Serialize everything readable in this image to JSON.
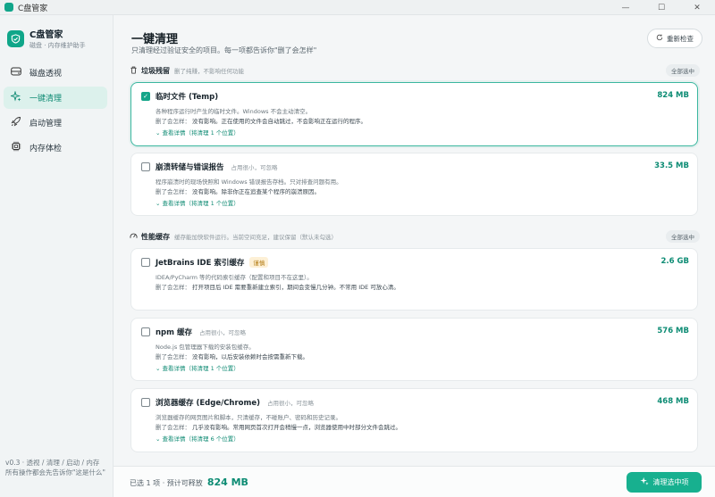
{
  "window": {
    "title": "C盘管家",
    "minimize": "—",
    "maximize": "☐",
    "close": "✕"
  },
  "sidebar": {
    "app_name": "C盘管家",
    "app_sub": "磁盘 · 内存维护助手",
    "items": [
      {
        "label": "磁盘透视",
        "icon": "disk-icon"
      },
      {
        "label": "一键清理",
        "icon": "sparkle-icon"
      },
      {
        "label": "启动管理",
        "icon": "rocket-icon"
      },
      {
        "label": "内存体检",
        "icon": "chip-icon"
      }
    ],
    "active_index": 1,
    "footer": "v0.3 · 透视 / 清理 / 启动 / 内存\n所有操作都会先告诉你\"这是什么\""
  },
  "header": {
    "title": "一键清理",
    "subtitle": "只清理经过验证安全的项目。每一项都告诉你\"删了会怎样\"",
    "recheck_label": "重新检查"
  },
  "sections": [
    {
      "title": "垃圾残留",
      "hint": "删了纯赚，不影响任何功能",
      "select_all": "全部选中",
      "items": [
        {
          "title": "临时文件 (Temp)",
          "tag": "",
          "badge": "",
          "size": "824 MB",
          "checked": true,
          "desc": "各种程序运行时产生的临时文件。Windows 不会主动清空。",
          "impact_label": "删了会怎样：",
          "impact": "没有影响。正在使用的文件会自动跳过，不会影响正在运行的程序。",
          "more": "查看详情（将清理 1 个位置）"
        },
        {
          "title": "崩溃转储与错误报告",
          "tag": "占用很小，可忽略",
          "badge": "",
          "size": "33.5 MB",
          "checked": false,
          "desc": "程序崩溃时的现场快照和 Windows 错误报告存档。只对排查问题有用。",
          "impact_label": "删了会怎样：",
          "impact": "没有影响。除非你正在追查某个程序的崩溃原因。",
          "more": "查看详情（将清理 1 个位置）"
        }
      ]
    },
    {
      "title": "性能缓存",
      "hint": "缓存能加快软件运行。当前空间充足，建议保留（默认未勾选）",
      "select_all": "全部选中",
      "items": [
        {
          "title": "JetBrains IDE 索引缓存",
          "tag": "",
          "badge": "谨慎",
          "size": "2.6 GB",
          "checked": false,
          "desc": "IDEA/PyCharm 等的代码索引缓存（配置和项目不在这里）。",
          "impact_label": "删了会怎样：",
          "impact": "打开项目后 IDE 需要重新建立索引，期间会变慢几分钟。不常用 IDE 可放心清。",
          "more": ""
        },
        {
          "title": "npm 缓存",
          "tag": "占用很小，可忽略",
          "badge": "",
          "size": "576 MB",
          "checked": false,
          "desc": "Node.js 包管理器下载的安装包缓存。",
          "impact_label": "删了会怎样：",
          "impact": "没有影响，以后安装依赖时会按需重新下载。",
          "more": "查看详情（将清理 1 个位置）"
        },
        {
          "title": "浏览器缓存 (Edge/Chrome)",
          "tag": "占用很小，可忽略",
          "badge": "",
          "size": "468 MB",
          "checked": false,
          "desc": "浏览器缓存的网页图片和脚本，只清缓存，不碰账户、密码和历史记录。",
          "impact_label": "删了会怎样：",
          "impact": "几乎没有影响。常用网页首次打开会稍慢一点，浏览器使用中时部分文件会跳过。",
          "more": "查看详情（将清理 6 个位置）"
        }
      ]
    }
  ],
  "bottom": {
    "summary": "已选 1 项 · 预计可释放",
    "amount": "824 MB",
    "clean_label": "清理选中项"
  },
  "colors": {
    "accent": "#14a589",
    "active_bg": "#dcf1ec",
    "size_text": "#0d8c74"
  }
}
